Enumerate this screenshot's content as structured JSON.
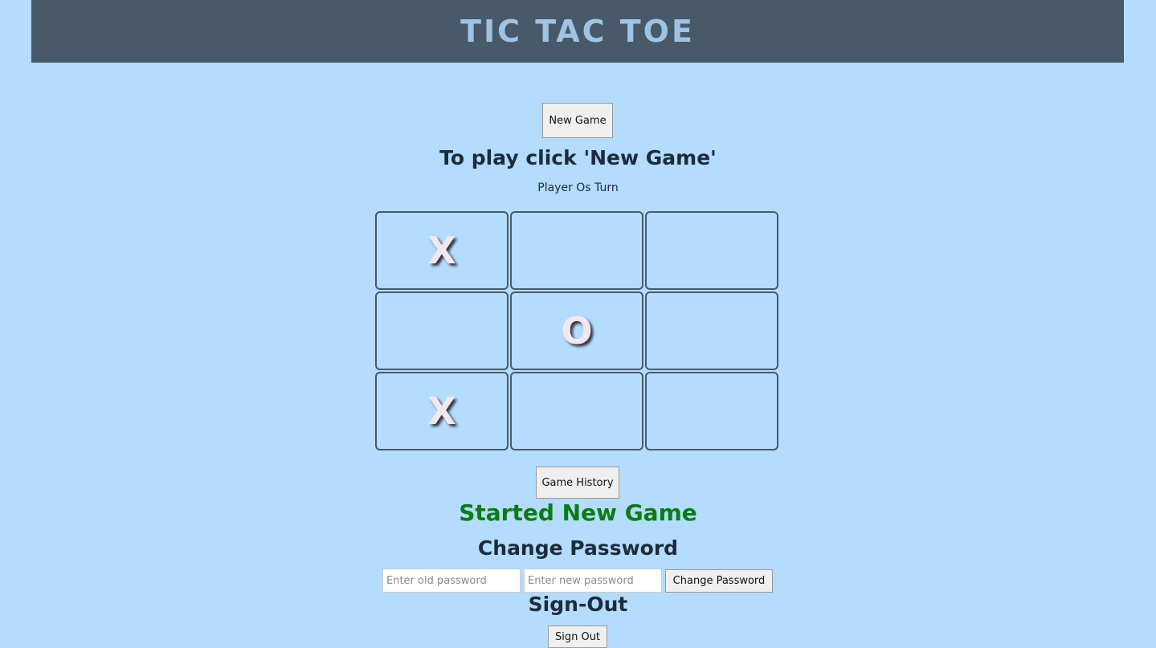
{
  "header": {
    "title": "TIC TAC TOE"
  },
  "controls": {
    "new_game_label": "New Game"
  },
  "status": {
    "instruction": "To play click 'New Game'",
    "turn": "Player Os Turn",
    "message": "Started New Game",
    "message_color": "#0a7d12"
  },
  "board": {
    "cells": [
      "X",
      "",
      "",
      "",
      "O",
      "",
      "X",
      "",
      ""
    ]
  },
  "history": {
    "button_label": "Game History"
  },
  "change_password": {
    "heading": "Change Password",
    "old_placeholder": "Enter old password",
    "new_placeholder": "Enter new password",
    "button_label": "Change Password"
  },
  "sign_out": {
    "heading": "Sign-Out",
    "button_label": "Sign Out"
  }
}
